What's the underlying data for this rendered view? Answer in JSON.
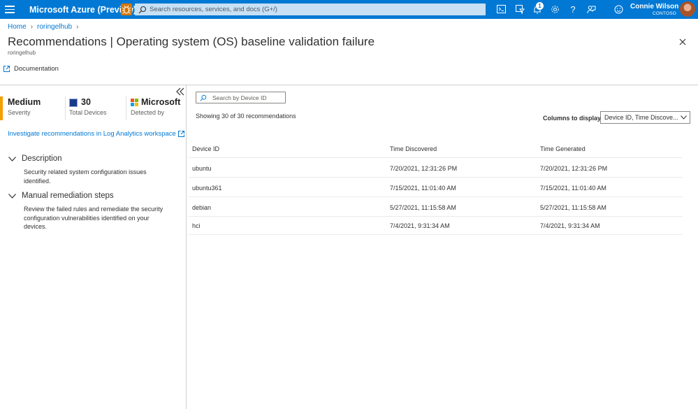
{
  "topbar": {
    "brand": "Microsoft Azure (Preview)",
    "search_placeholder": "Search resources, services, and docs (G+/)",
    "notification_count": "1",
    "user_name": "Connie Wilson",
    "tenant": "CONTOSO"
  },
  "breadcrumb": [
    "Home",
    "roringelhub"
  ],
  "header": {
    "title": "Recommendations | Operating system (OS) baseline validation failure",
    "more": "···",
    "subtitle": "roringelhub",
    "documentation_label": "Documentation"
  },
  "summary": {
    "severity": {
      "value": "Medium",
      "label": "Severity",
      "color": "#f59e00"
    },
    "devices": {
      "value": "30",
      "label": "Total Devices"
    },
    "detected": {
      "value": "Microsoft",
      "label": "Detected by"
    }
  },
  "log_analytics_link": "Investigate recommendations in Log Analytics workspace",
  "sections": {
    "description": {
      "title": "Description",
      "body": "Security related system configuration issues identified."
    },
    "remediation": {
      "title": "Manual remediation steps",
      "body": "Review the failed rules and remediate the security configuration vulnerabilities identified on your devices."
    }
  },
  "main": {
    "search_placeholder": "Search by Device ID",
    "showing": "Showing 30 of 30 recommendations",
    "columns_label": "Columns to display",
    "columns_value": "Device ID, Time Discove...",
    "table": {
      "headers": [
        "Device ID",
        "Time Discovered",
        "Time Generated"
      ],
      "rows": [
        [
          "ubuntu",
          "7/20/2021, 12:31:26 PM",
          "7/20/2021, 12:31:26 PM"
        ],
        [
          "ubuntu361",
          "7/15/2021, 11:01:40 AM",
          "7/15/2021, 11:01:40 AM"
        ],
        [
          "debian",
          "5/27/2021, 11:15:58 AM",
          "5/27/2021, 11:15:58 AM"
        ],
        [
          "hci",
          "7/4/2021, 9:31:34 AM",
          "7/4/2021, 9:31:34 AM"
        ]
      ]
    }
  },
  "colors": {
    "accent": "#0078d4",
    "severity_medium": "#f59e00"
  }
}
